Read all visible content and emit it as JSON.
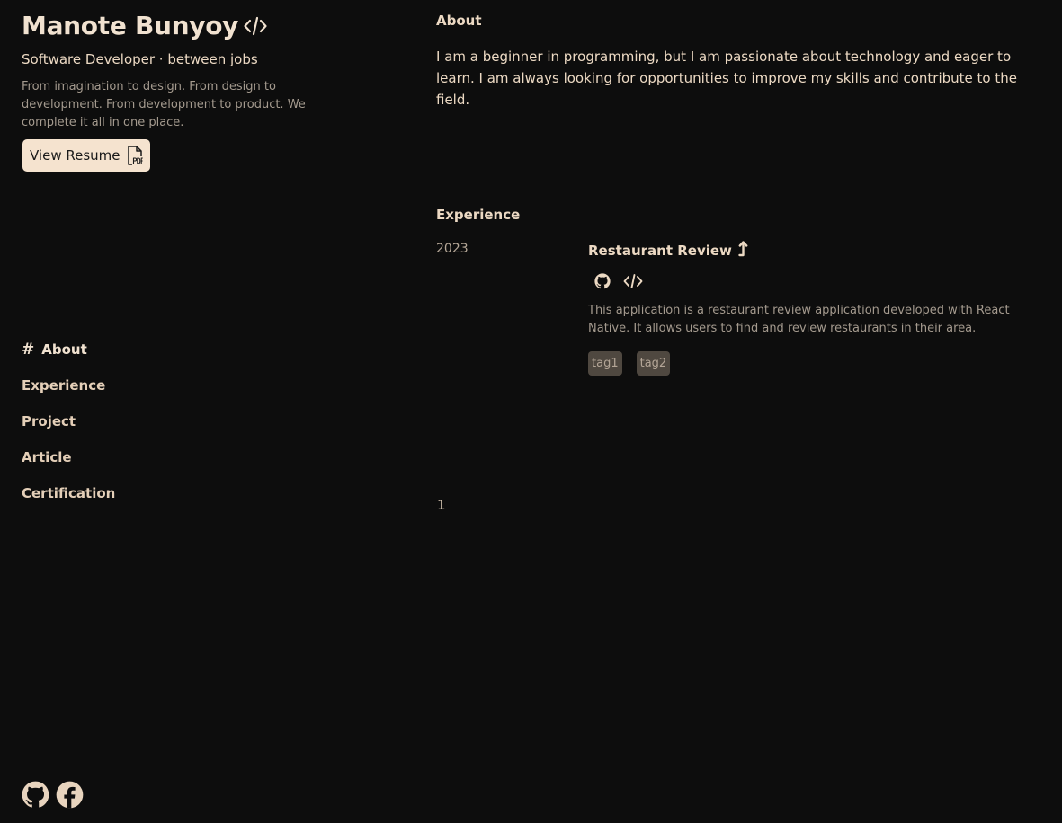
{
  "profile": {
    "name": "Manote Bunyoy",
    "subtitle": "Software Developer · between jobs",
    "tagline": "From imagination to design. From design to development. From development to product. We complete it all in one place.",
    "resume_button": "View Resume"
  },
  "nav": {
    "active_marker": "#",
    "items": [
      {
        "label": "About"
      },
      {
        "label": "Experience"
      },
      {
        "label": "Project"
      },
      {
        "label": "Article"
      },
      {
        "label": "Certification"
      }
    ]
  },
  "socials": [
    "github-icon",
    "facebook-icon"
  ],
  "about": {
    "title": "About",
    "text": "I am a beginner in programming, but I am passionate about technology and eager to learn. I am always looking for opportunities to improve my skills and contribute to the field."
  },
  "experience": {
    "title": "Experience",
    "items": [
      {
        "year": "2023",
        "title": "Restaurant Review",
        "description": "This application is a restaurant review application developed with React Native. It allows users to find and review restaurants in their area.",
        "tags": [
          "tag1",
          "tag2"
        ]
      }
    ]
  },
  "pagination": {
    "current": "1"
  },
  "colors": {
    "background": "#0d0d0d",
    "accent": "#f5e3cf",
    "text": "#ecd9c3",
    "muted": "#a49a8e",
    "tag_bg": "#4f4840"
  }
}
